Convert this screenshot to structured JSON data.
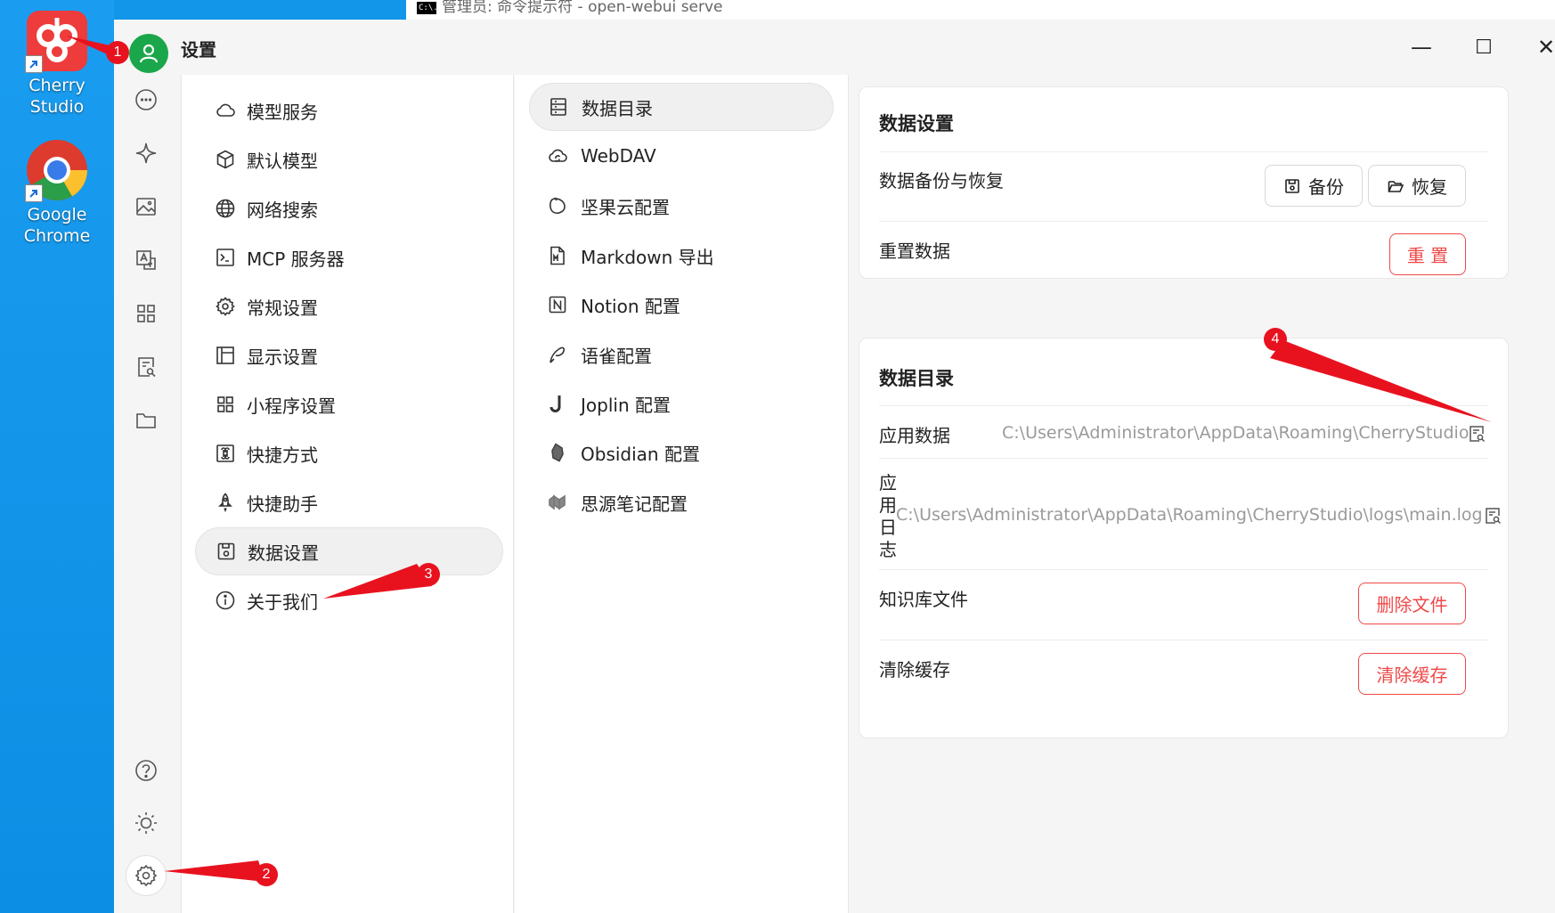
{
  "desktop": {
    "icons": [
      {
        "label_line1": "Cherry",
        "label_line2": "Studio"
      },
      {
        "label_line1": "Google",
        "label_line2": "Chrome"
      }
    ]
  },
  "background_window": {
    "title": "管理员: 命令提示符 - open-webui  serve",
    "cmd_icon_text": "C:\\."
  },
  "window": {
    "title": "设置",
    "minimize": "—",
    "maximize": "☐",
    "close": "✕"
  },
  "rail": {
    "icons": [
      "chat-icon",
      "sparkle-icon",
      "image-icon",
      "translate-icon",
      "apps-grid-icon",
      "doc-search-icon",
      "folder-icon",
      "help-icon",
      "sun-icon",
      "settings-gear-icon"
    ]
  },
  "menu": {
    "items": [
      {
        "label": "模型服务",
        "icon": "cloud-icon"
      },
      {
        "label": "默认模型",
        "icon": "cube-icon"
      },
      {
        "label": "网络搜索",
        "icon": "globe-icon"
      },
      {
        "label": "MCP 服务器",
        "icon": "terminal-icon"
      },
      {
        "label": "常规设置",
        "icon": "gear-icon"
      },
      {
        "label": "显示设置",
        "icon": "layout-icon"
      },
      {
        "label": "小程序设置",
        "icon": "grid-icon"
      },
      {
        "label": "快捷方式",
        "icon": "command-icon"
      },
      {
        "label": "快捷助手",
        "icon": "rocket-icon"
      },
      {
        "label": "数据设置",
        "icon": "save-icon",
        "active": true
      },
      {
        "label": "关于我们",
        "icon": "info-icon"
      }
    ]
  },
  "submenu": {
    "items": [
      {
        "label": "数据目录",
        "icon": "database-icon",
        "active": true
      },
      {
        "label": "WebDAV",
        "icon": "cloud-sync-icon"
      },
      {
        "label": "坚果云配置",
        "icon": "nut-icon"
      },
      {
        "label": "Markdown 导出",
        "icon": "markdown-file-icon"
      },
      {
        "label": "Notion 配置",
        "icon": "notion-icon"
      },
      {
        "label": "语雀配置",
        "icon": "yuque-icon"
      },
      {
        "label": "Joplin 配置",
        "icon": "joplin-icon"
      },
      {
        "label": "Obsidian 配置",
        "icon": "obsidian-icon"
      },
      {
        "label": "思源笔记配置",
        "icon": "siyuan-icon"
      }
    ]
  },
  "data_settings": {
    "title": "数据设置",
    "backup_label": "数据备份与恢复",
    "backup_button": "备份",
    "restore_button": "恢复",
    "reset_label": "重置数据",
    "reset_button": "重 置"
  },
  "data_dir": {
    "title": "数据目录",
    "app_data_label": "应用数据",
    "app_data_path": "C:\\Users\\Administrator\\AppData\\Roaming\\CherryStudio",
    "app_log_label": [
      "应",
      "用",
      "日",
      "志"
    ],
    "app_log_path": "C:\\Users\\Administrator\\AppData\\Roaming\\CherryStudio\\logs\\main.log",
    "kb_label": "知识库文件",
    "kb_button": "删除文件",
    "cache_label": "清除缓存",
    "cache_button": "清除缓存"
  },
  "annotations": [
    "1",
    "2",
    "3",
    "4"
  ],
  "colors": {
    "desktop": "#1196ea",
    "danger": "#f04848",
    "annotation": "#e8121f",
    "avatar": "#1aa64a"
  }
}
